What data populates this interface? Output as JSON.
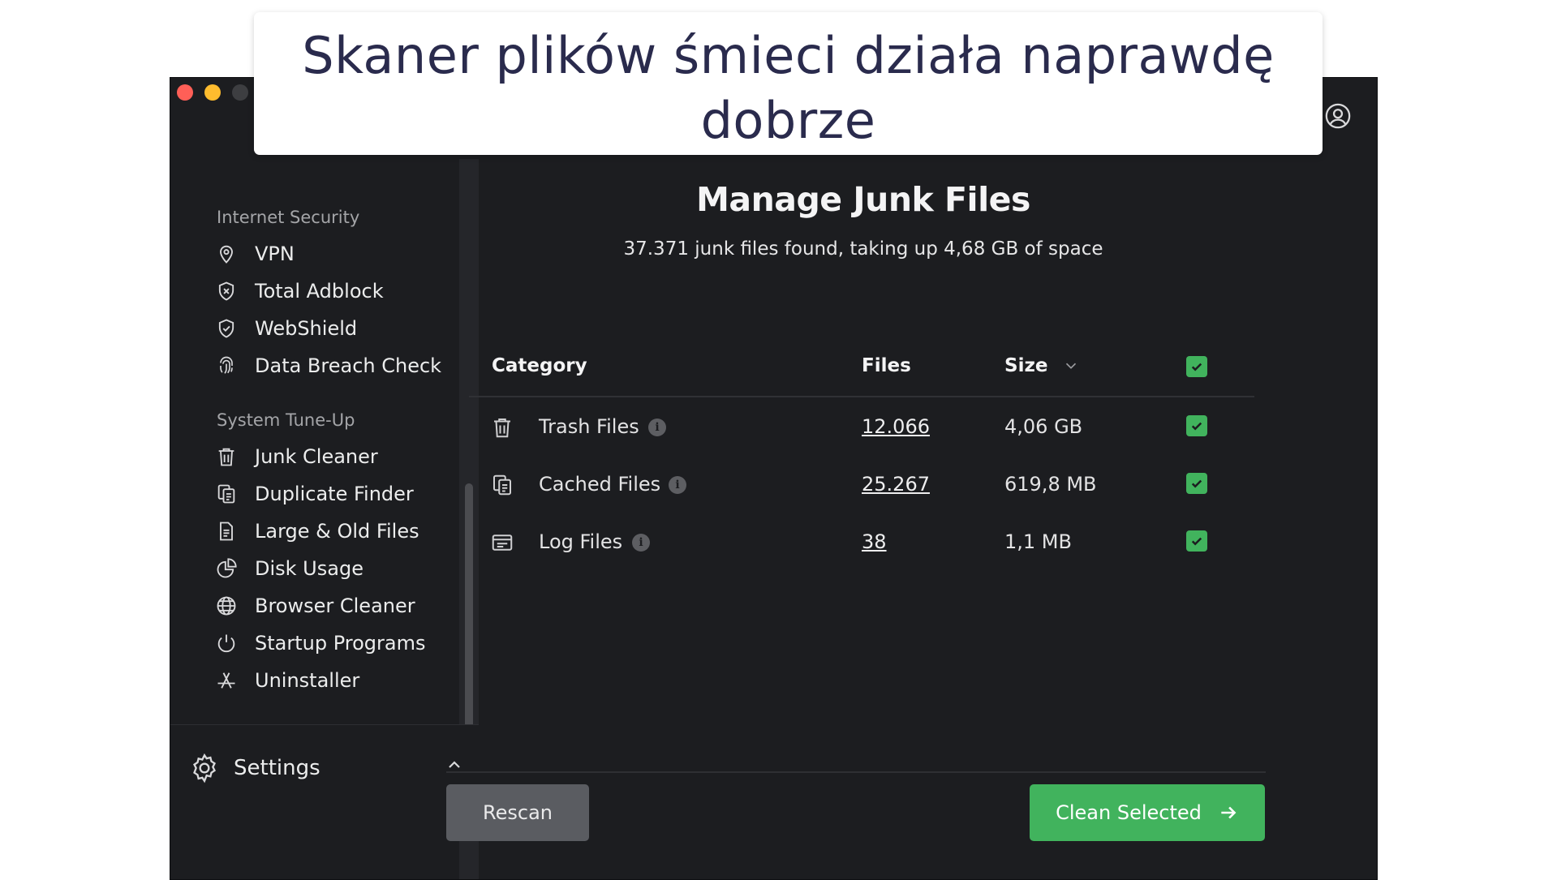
{
  "caption": {
    "line1": "Skaner plików śmieci działa naprawdę",
    "line2": "dobrze"
  },
  "sidebar": {
    "sections": [
      {
        "title": "Internet Security",
        "items": [
          {
            "label": "VPN",
            "icon": "location-pin-icon"
          },
          {
            "label": "Total Adblock",
            "icon": "shield-x-icon"
          },
          {
            "label": "WebShield",
            "icon": "shield-check-icon"
          },
          {
            "label": "Data Breach Check",
            "icon": "fingerprint-icon"
          }
        ]
      },
      {
        "title": "System Tune-Up",
        "items": [
          {
            "label": "Junk Cleaner",
            "icon": "trash-icon"
          },
          {
            "label": "Duplicate Finder",
            "icon": "duplicate-icon"
          },
          {
            "label": "Large & Old Files",
            "icon": "document-icon"
          },
          {
            "label": "Disk Usage",
            "icon": "pie-chart-icon"
          },
          {
            "label": "Browser Cleaner",
            "icon": "globe-icon"
          },
          {
            "label": "Startup Programs",
            "icon": "power-icon"
          },
          {
            "label": "Uninstaller",
            "icon": "app-store-icon"
          }
        ]
      }
    ],
    "settings_label": "Settings"
  },
  "main": {
    "title": "Manage Junk Files",
    "subtitle": "37.371 junk files found, taking up 4,68 GB of space",
    "table": {
      "headers": {
        "category": "Category",
        "files": "Files",
        "size": "Size"
      },
      "rows": [
        {
          "label": "Trash Files",
          "files": "12.066",
          "size": "4,06 GB",
          "checked": true
        },
        {
          "label": "Cached Files",
          "files": "25.267",
          "size": "619,8 MB",
          "checked": true
        },
        {
          "label": "Log Files",
          "files": "38",
          "size": "1,1 MB",
          "checked": true
        }
      ]
    },
    "buttons": {
      "rescan": "Rescan",
      "clean": "Clean Selected"
    }
  },
  "colors": {
    "accent_green": "#41b35d",
    "window_bg": "#1c1d20",
    "caption_text": "#2a2b4d"
  }
}
